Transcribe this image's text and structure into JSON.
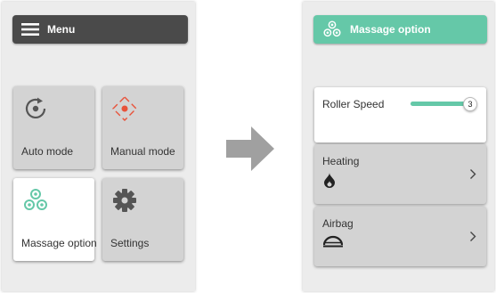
{
  "left_screen": {
    "header": {
      "title": "Menu",
      "icon": "hamburger-icon"
    },
    "tiles": [
      {
        "label": "Auto mode",
        "icon": "auto-rotate-icon"
      },
      {
        "label": "Manual mode",
        "icon": "manual-target-icon"
      },
      {
        "label": "Massage option",
        "icon": "massage-circles-icon",
        "active": true
      },
      {
        "label": "Settings",
        "icon": "gear-icon"
      }
    ]
  },
  "transition": {
    "icon": "right-arrow-icon"
  },
  "right_screen": {
    "header": {
      "title": "Massage option",
      "icon": "massage-circles-icon"
    },
    "options": [
      {
        "label": "Roller Speed",
        "value": "3",
        "level": 1.0,
        "control": "slider"
      },
      {
        "label": "Heating",
        "icon": "flame-drop-icon",
        "control": "chevron-right-icon"
      },
      {
        "label": "Airbag",
        "icon": "airbag-dome-icon",
        "control": "chevron-right-icon"
      }
    ]
  },
  "colors": {
    "accent": "#65c8a8",
    "accent_dark": "#e8523a",
    "menu_header": "#4a4a4a",
    "tile": "#d3d3d3",
    "panel": "#ececec",
    "arrow": "#a0a0a0"
  }
}
